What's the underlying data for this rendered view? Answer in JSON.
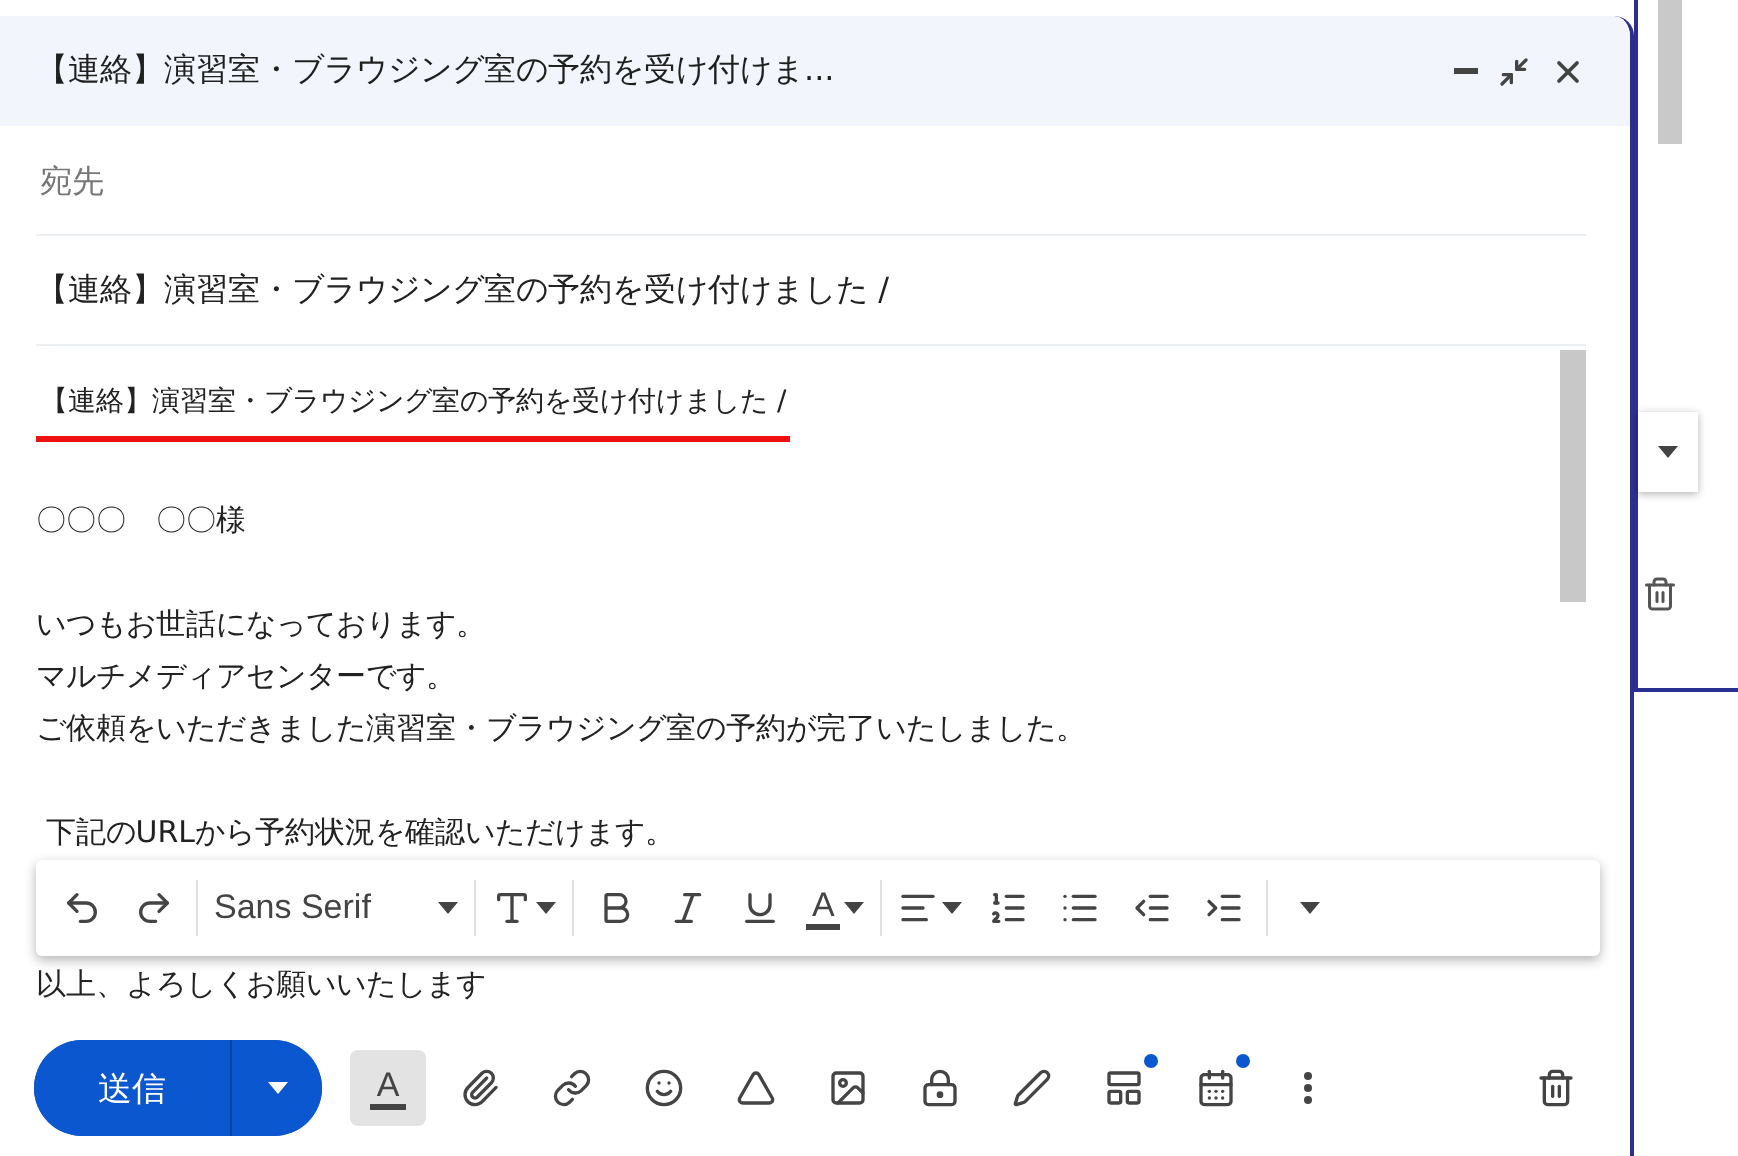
{
  "window": {
    "title": "【連絡】演習室・ブラウジング室の予約を受け付けま..."
  },
  "to": {
    "placeholder": "宛先"
  },
  "subject": {
    "value": "【連絡】演習室・ブラウジング室の予約を受け付けました /"
  },
  "body": {
    "paragraphs": [
      {
        "lines": [
          {
            "text": "【連絡】演習室・ブラウジング室の予約を受け付けました /",
            "underlined": true
          }
        ]
      },
      {
        "lines": [
          {
            "text": "〇〇〇　〇〇様",
            "underlined": false
          }
        ]
      },
      {
        "lines": [
          {
            "text": "いつもお世話になっております。",
            "underlined": false
          },
          {
            "text": "マルチメディアセンターです。",
            "underlined": false
          },
          {
            "text": "ご依頼をいただきました演習室・ブラウジング室の予約が完了いたしました。",
            "underlined": false
          }
        ]
      },
      {
        "lines": [
          {
            "text": " 下記のURLから予約状況を確認いただけます。",
            "underlined": false
          }
        ]
      }
    ],
    "closing": "以上、よろしくお願いいたします"
  },
  "format_bar": {
    "font": "Sans Serif",
    "items": [
      {
        "kind": "undo"
      },
      {
        "kind": "redo"
      },
      {
        "kind": "font"
      },
      {
        "kind": "size"
      },
      {
        "kind": "bold"
      },
      {
        "kind": "italic"
      },
      {
        "kind": "underline"
      },
      {
        "kind": "color",
        "text": "A"
      },
      {
        "kind": "align"
      },
      {
        "kind": "numbered"
      },
      {
        "kind": "bulleted"
      },
      {
        "kind": "outdent"
      },
      {
        "kind": "indent"
      },
      {
        "kind": "more"
      }
    ]
  },
  "send": {
    "label": "送信"
  },
  "actions": [
    {
      "kind": "format",
      "text": "A",
      "selected": true
    },
    {
      "kind": "attach",
      "selected": false
    },
    {
      "kind": "link",
      "selected": false
    },
    {
      "kind": "emoji",
      "selected": false
    },
    {
      "kind": "drive",
      "selected": false
    },
    {
      "kind": "photo",
      "selected": false
    },
    {
      "kind": "lock",
      "selected": false
    },
    {
      "kind": "pen",
      "selected": false
    },
    {
      "kind": "layout",
      "selected": false,
      "dot": true
    },
    {
      "kind": "calendar",
      "selected": false,
      "dot": true
    },
    {
      "kind": "more",
      "selected": false
    }
  ]
}
